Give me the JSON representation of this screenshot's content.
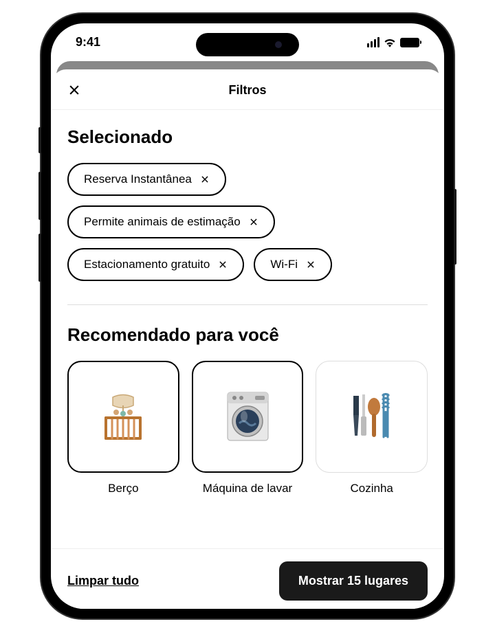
{
  "status": {
    "time": "9:41"
  },
  "sheet": {
    "title": "Filtros"
  },
  "selected": {
    "title": "Selecionado",
    "chips": [
      {
        "label": "Reserva Instantânea"
      },
      {
        "label": "Permite animais de estimação"
      },
      {
        "label": "Estacionamento gratuito"
      },
      {
        "label": "Wi-Fi"
      }
    ]
  },
  "recommended": {
    "title": "Recomendado para você",
    "items": [
      {
        "label": "Berço",
        "icon": "crib",
        "selected": true
      },
      {
        "label": "Máquina de lavar",
        "icon": "washer",
        "selected": true
      },
      {
        "label": "Cozinha",
        "icon": "kitchen",
        "selected": false
      }
    ]
  },
  "footer": {
    "clear": "Limpar tudo",
    "show": "Mostrar 15 lugares"
  }
}
